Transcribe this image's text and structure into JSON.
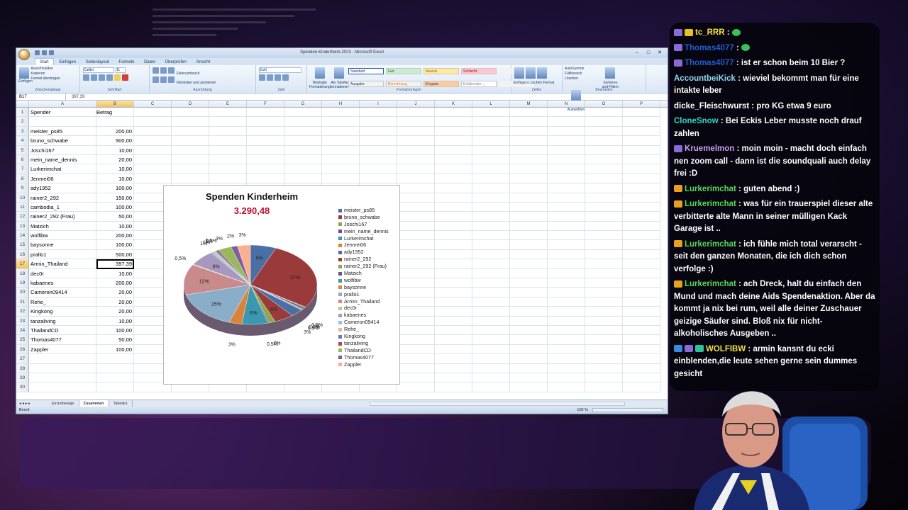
{
  "excel": {
    "window_title": "Spenden-Kinderheim-2023 - Microsoft Excel",
    "tabs": [
      "Start",
      "Einfügen",
      "Seitenlayout",
      "Formeln",
      "Daten",
      "Überprüfen",
      "Ansicht"
    ],
    "ribbon": {
      "groups": [
        "Zwischenablage",
        "Schriftart",
        "Ausrichtung",
        "Zahl",
        "Formatvorlagen",
        "Zellen",
        "Bearbeiten"
      ],
      "paste_label": "Einfügen",
      "clip_items": [
        "Ausschneiden",
        "Kopieren",
        "Format übertragen"
      ],
      "font_name": "Calibri",
      "font_size": "11",
      "wrap_label": "Zeilenumbruch",
      "merge_label": "Verbinden und zentrieren",
      "number_format": "Zahl",
      "cond_format": "Bedingte Formatierung",
      "as_table": "Als Tabelle formatieren",
      "styles": [
        "Standard",
        "Gut",
        "Neutral",
        "Schlecht",
        "",
        "Ausgabe",
        "Berechnung",
        "Eingabe",
        "Erklärender ...",
        ""
      ],
      "cells_buttons": [
        "Einfügen",
        "Löschen",
        "Format"
      ],
      "edit_items": [
        "AutoSumme",
        "Füllbereich",
        "Löschen"
      ],
      "sort_label": "Sortieren und Filtern",
      "find_label": "Suchen und Auswählen"
    },
    "name_box": "B17",
    "formula": "397,39",
    "columns": [
      "A",
      "B",
      "C",
      "D",
      "E",
      "F",
      "G",
      "H",
      "I",
      "J",
      "K",
      "L",
      "M",
      "N",
      "O",
      "P"
    ],
    "selected_column": "B",
    "selected_row": 17,
    "rows": [
      {
        "n": "1",
        "a": "Spender",
        "b": "Betrag"
      },
      {
        "n": "2",
        "a": "",
        "b": ""
      },
      {
        "n": "3",
        "a": "meister_ps85",
        "b": "200,00"
      },
      {
        "n": "4",
        "a": "bruno_schwabe",
        "b": "900,00"
      },
      {
        "n": "5",
        "a": "Joschi167",
        "b": "10,00"
      },
      {
        "n": "6",
        "a": "mein_name_dennis",
        "b": "20,00"
      },
      {
        "n": "7",
        "a": "Lurkerimchat",
        "b": "10,00"
      },
      {
        "n": "8",
        "a": "Jenmei06",
        "b": "10,00"
      },
      {
        "n": "9",
        "a": "ady1952",
        "b": "100,00"
      },
      {
        "n": "10",
        "a": "rainer2_292",
        "b": "150,00"
      },
      {
        "n": "11",
        "a": "cambodia_1",
        "b": "100,00"
      },
      {
        "n": "12",
        "a": "rainer2_292 (Frau)",
        "b": "50,00"
      },
      {
        "n": "13",
        "a": "Matzich",
        "b": "10,00"
      },
      {
        "n": "14",
        "a": "wolfibw",
        "b": "200,00"
      },
      {
        "n": "15",
        "a": "baysonne",
        "b": "100,00"
      },
      {
        "n": "16",
        "a": "prallo1",
        "b": "500,00"
      },
      {
        "n": "17",
        "a": "Armin_Thailand",
        "b": "397,39"
      },
      {
        "n": "18",
        "a": "dec0r",
        "b": "10,00"
      },
      {
        "n": "19",
        "a": "kabaenes",
        "b": "200,00"
      },
      {
        "n": "20",
        "a": "Cameron09414",
        "b": "20,00"
      },
      {
        "n": "21",
        "a": "Rehe_",
        "b": "20,00"
      },
      {
        "n": "22",
        "a": "Kingkong",
        "b": "20,00"
      },
      {
        "n": "23",
        "a": "tanzaliving",
        "b": "10,00"
      },
      {
        "n": "24",
        "a": "ThailandCD",
        "b": "100,00"
      },
      {
        "n": "25",
        "a": "Thomas4077",
        "b": "50,00"
      },
      {
        "n": "26",
        "a": "Zappler",
        "b": "100,00"
      },
      {
        "n": "27",
        "a": "",
        "b": ""
      },
      {
        "n": "28",
        "a": "",
        "b": ""
      },
      {
        "n": "29",
        "a": "",
        "b": ""
      },
      {
        "n": "30",
        "a": "",
        "b": ""
      }
    ],
    "sheet_tabs": [
      "Einzelbelege",
      "Zusammen",
      "Tabelle1"
    ],
    "active_sheet": "Zusammen",
    "status": "Bereit",
    "zoom": "100 %"
  },
  "chart_data": {
    "type": "pie",
    "title": "Spenden Kinderheim",
    "subtitle": "3.290,48",
    "categories": [
      "meister_ps85",
      "bruno_schwabe",
      "Joschi167",
      "mein_name_dennis",
      "Lurkerimchat",
      "Jenmei06",
      "ady1952",
      "rainer2_292",
      "rainer2_292 (Frau)",
      "Matzich",
      "wolfibw",
      "baysonne",
      "prallo1",
      "Armin_Thailand",
      "dec0r",
      "kabaenes",
      "Cameron09414",
      "Rehe_",
      "Kingkong",
      "tanzaliving",
      "ThailandCD",
      "Thomas4077",
      "Zappler"
    ],
    "values": [
      200,
      900,
      10,
      20,
      10,
      10,
      100,
      150,
      50,
      10,
      200,
      100,
      500,
      397.39,
      10,
      200,
      20,
      20,
      20,
      10,
      100,
      50,
      100
    ],
    "pct_labels": [
      "6%",
      "27%",
      "0,5%",
      "1%",
      "0,5%",
      "0,5%",
      "3%",
      "5%",
      "2%",
      "0,5%",
      "6%",
      "3%",
      "15%",
      "12%",
      "0,5%",
      "6%",
      "1%",
      "1%",
      "1%",
      "0,5%",
      "3%",
      "2%",
      "3%"
    ],
    "legend_placement": "right",
    "colors": [
      "#4a6fa5",
      "#9b3a3a",
      "#8aaa4a",
      "#6a4f8a",
      "#3a98b0",
      "#d8843a",
      "#4a6fa5",
      "#9b3a3a",
      "#8aaa4a",
      "#6a4f8a",
      "#3a98b0",
      "#d8843a",
      "#8aaec8",
      "#c88a8a",
      "#b8cc8a",
      "#a898c0",
      "#8cc8d8",
      "#f0b88a",
      "#5a80b8",
      "#b04a4a",
      "#9ab85a",
      "#7a60a0",
      "#f8b090"
    ]
  },
  "chat": {
    "messages": [
      {
        "user": "tc_RRR",
        "user_color": "#f0e040",
        "text": "",
        "badges": [
          "#8a6ad8",
          "#e8c020"
        ],
        "emote": true
      },
      {
        "user": "Thomas4077",
        "user_color": "#1e5fd0",
        "text": "",
        "badges": [
          "#8a6ad8"
        ],
        "emote": true
      },
      {
        "user": "Thomas4077",
        "user_color": "#1e5fd0",
        "text": "ist er schon beim 10 Bier ?",
        "badges": [
          "#8a6ad8"
        ],
        "emote": false
      },
      {
        "user": "AccountbeiKick",
        "user_color": "#8fd8e8",
        "text": "wieviel bekommt man für eine intakte leber",
        "badges": [],
        "emote": false
      },
      {
        "user": "dicke_Fleischwurst",
        "user_color": "#ffffff",
        "text": "pro KG etwa 9 euro",
        "badges": [],
        "emote": false
      },
      {
        "user": "CloneSnow",
        "user_color": "#30d8c0",
        "text": "Bei Eckis Leber musste noch drauf zahlen",
        "badges": [],
        "emote": false
      },
      {
        "user": "Kruemelmon",
        "user_color": "#c8a0f0",
        "text": "moin moin - macht doch einfach nen zoom call - dann ist die soundquali auch delay frei :D",
        "badges": [
          "#8a6ad8"
        ],
        "emote": false
      },
      {
        "user": "Lurkerimchat",
        "user_color": "#5ad85a",
        "text": "guten abend :)",
        "badges": [
          "#e8a020"
        ],
        "emote": false
      },
      {
        "user": "Lurkerimchat",
        "user_color": "#5ad85a",
        "text": "was für ein trauerspiel dieser alte verbitterte alte Mann in seiner mülligen Kack Garage ist ..",
        "badges": [
          "#e8a020"
        ],
        "emote": false
      },
      {
        "user": "Lurkerimchat",
        "user_color": "#5ad85a",
        "text": "ich fühle mich total verarscht - seit den ganzen Monaten, die ich dich schon verfolge :)",
        "badges": [
          "#e8a020"
        ],
        "emote": false
      },
      {
        "user": "Lurkerimchat",
        "user_color": "#5ad85a",
        "text": "ach Dreck, halt du einfach den Mund und mach deine Aids Spendenaktion. Aber da kommt ja nix bei rum, weil alle deiner Zuschauer geizige Säufer sind. Bloß nix für nicht-alkoholisches Ausgeben ..",
        "badges": [
          "#e8a020"
        ],
        "emote": false
      },
      {
        "user": "WOLFIBW",
        "user_color": "#f0e040",
        "text": "armin kansnt du ecki einblenden,die leute sehen gerne sein dummes gesicht",
        "badges": [
          "#3a8ae0",
          "#8a6ad8",
          "#30c0a0"
        ],
        "emote": false
      }
    ]
  }
}
